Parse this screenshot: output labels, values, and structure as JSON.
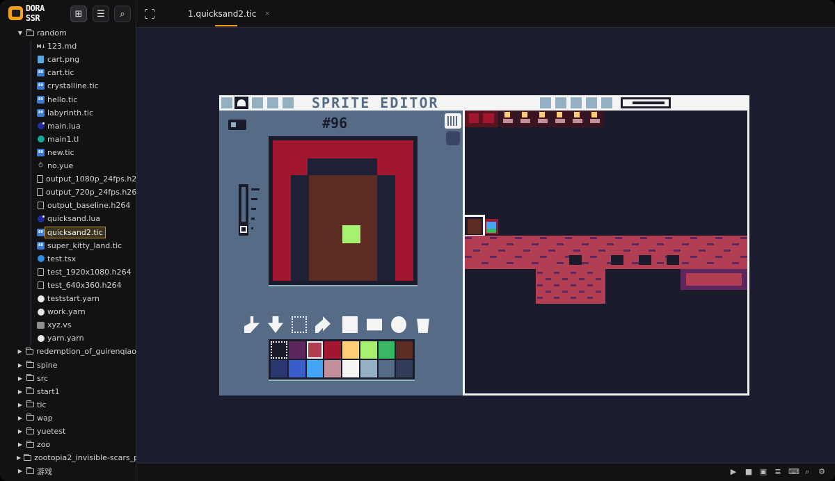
{
  "app": {
    "logo_text": "DORA SSR",
    "tab_title": "1.quicksand2.tic",
    "tab_close": "×"
  },
  "tree": [
    {
      "label": "random",
      "type": "folder",
      "open": true,
      "depth": 1
    },
    {
      "label": "123.md",
      "type": "md",
      "depth": 2
    },
    {
      "label": "cart.png",
      "type": "png",
      "depth": 2
    },
    {
      "label": "cart.tic",
      "type": "tic",
      "depth": 2
    },
    {
      "label": "crystalline.tic",
      "type": "tic",
      "depth": 2
    },
    {
      "label": "hello.tic",
      "type": "tic",
      "depth": 2
    },
    {
      "label": "labyrinth.tic",
      "type": "tic",
      "depth": 2
    },
    {
      "label": "main.lua",
      "type": "lua",
      "depth": 2
    },
    {
      "label": "main1.tl",
      "type": "tl",
      "depth": 2
    },
    {
      "label": "new.tic",
      "type": "tic",
      "depth": 2
    },
    {
      "label": "no.yue",
      "type": "yue",
      "depth": 2
    },
    {
      "label": "output_1080p_24fps.h264",
      "type": "file",
      "depth": 2
    },
    {
      "label": "output_720p_24fps.h264",
      "type": "file",
      "depth": 2
    },
    {
      "label": "output_baseline.h264",
      "type": "file",
      "depth": 2
    },
    {
      "label": "quicksand.lua",
      "type": "lua",
      "depth": 2
    },
    {
      "label": "quicksand2.tic",
      "type": "tic",
      "depth": 2,
      "selected": true
    },
    {
      "label": "super_kitty_land.tic",
      "type": "tic",
      "depth": 2
    },
    {
      "label": "test.tsx",
      "type": "tsx",
      "depth": 2
    },
    {
      "label": "test_1920x1080.h264",
      "type": "file",
      "depth": 2
    },
    {
      "label": "test_640x360.h264",
      "type": "file",
      "depth": 2
    },
    {
      "label": "teststart.yarn",
      "type": "yarn",
      "depth": 2
    },
    {
      "label": "work.yarn",
      "type": "yarn",
      "depth": 2
    },
    {
      "label": "xyz.vs",
      "type": "vs",
      "depth": 2
    },
    {
      "label": "yarn.yarn",
      "type": "yarn",
      "depth": 2
    },
    {
      "label": "redemption_of_guirenqiao",
      "type": "folder",
      "depth": 1
    },
    {
      "label": "spine",
      "type": "folder",
      "depth": 1
    },
    {
      "label": "src",
      "type": "folder",
      "depth": 1
    },
    {
      "label": "start1",
      "type": "folder",
      "depth": 1
    },
    {
      "label": "tic",
      "type": "folder",
      "depth": 1
    },
    {
      "label": "wap",
      "type": "folder",
      "depth": 1
    },
    {
      "label": "yuetest",
      "type": "folder",
      "depth": 1
    },
    {
      "label": "zoo",
      "type": "folder",
      "depth": 1
    },
    {
      "label": "zootopia2_invisible-scars_p",
      "type": "folder",
      "depth": 1
    },
    {
      "label": "游戏",
      "type": "folder",
      "depth": 1
    }
  ],
  "icons": {
    "md_badge": "M↓",
    "tic_badge": "80"
  },
  "editor": {
    "title": "SPRITE EDITOR",
    "sprite_number": "#96",
    "palette": [
      "#1a1c2c",
      "#5d275d",
      "#b13e53",
      "#a3162f",
      "#ffcd75",
      "#a7f070",
      "#38b764",
      "#5c2b22",
      "#29366f",
      "#3b5dc9",
      "#41a6f6",
      "#c28f9b",
      "#f4f4f4",
      "#94b0c2",
      "#566c86",
      "#333c57"
    ],
    "selected_color_index": 2
  },
  "status_icons": [
    "play-icon",
    "stop-icon",
    "file-icon",
    "list-icon",
    "terminal-icon",
    "search-icon",
    "settings-icon"
  ]
}
